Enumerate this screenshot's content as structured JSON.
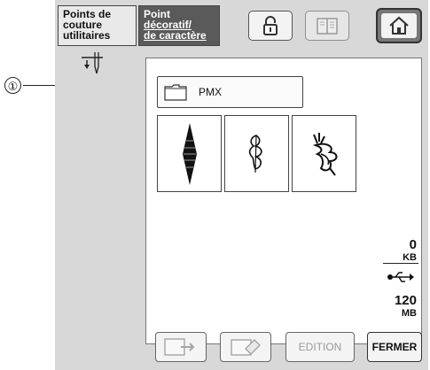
{
  "callout": {
    "number": "①"
  },
  "tabs": {
    "utility": {
      "line1": "Points de",
      "line2": "couture",
      "line3": "utilitaires"
    },
    "decorative": {
      "line1": "Point",
      "line2": "décoratif/",
      "line3": "de caractère"
    }
  },
  "toolbar": {
    "icons": [
      "lock-icon",
      "book-icon",
      "home-icon"
    ]
  },
  "file_list": {
    "folder_name": "PMX",
    "thumbnails": [
      "satin-diamond-stitch",
      "leaf-outline-stitch",
      "floral-motif-stitch"
    ]
  },
  "memory": {
    "used_value": "0",
    "used_unit": "KB",
    "free_value": "120",
    "free_unit": "MB",
    "device_icon": "usb-icon"
  },
  "bottom_bar": {
    "edition_label": "EDITION",
    "close_label": "FERMER"
  }
}
